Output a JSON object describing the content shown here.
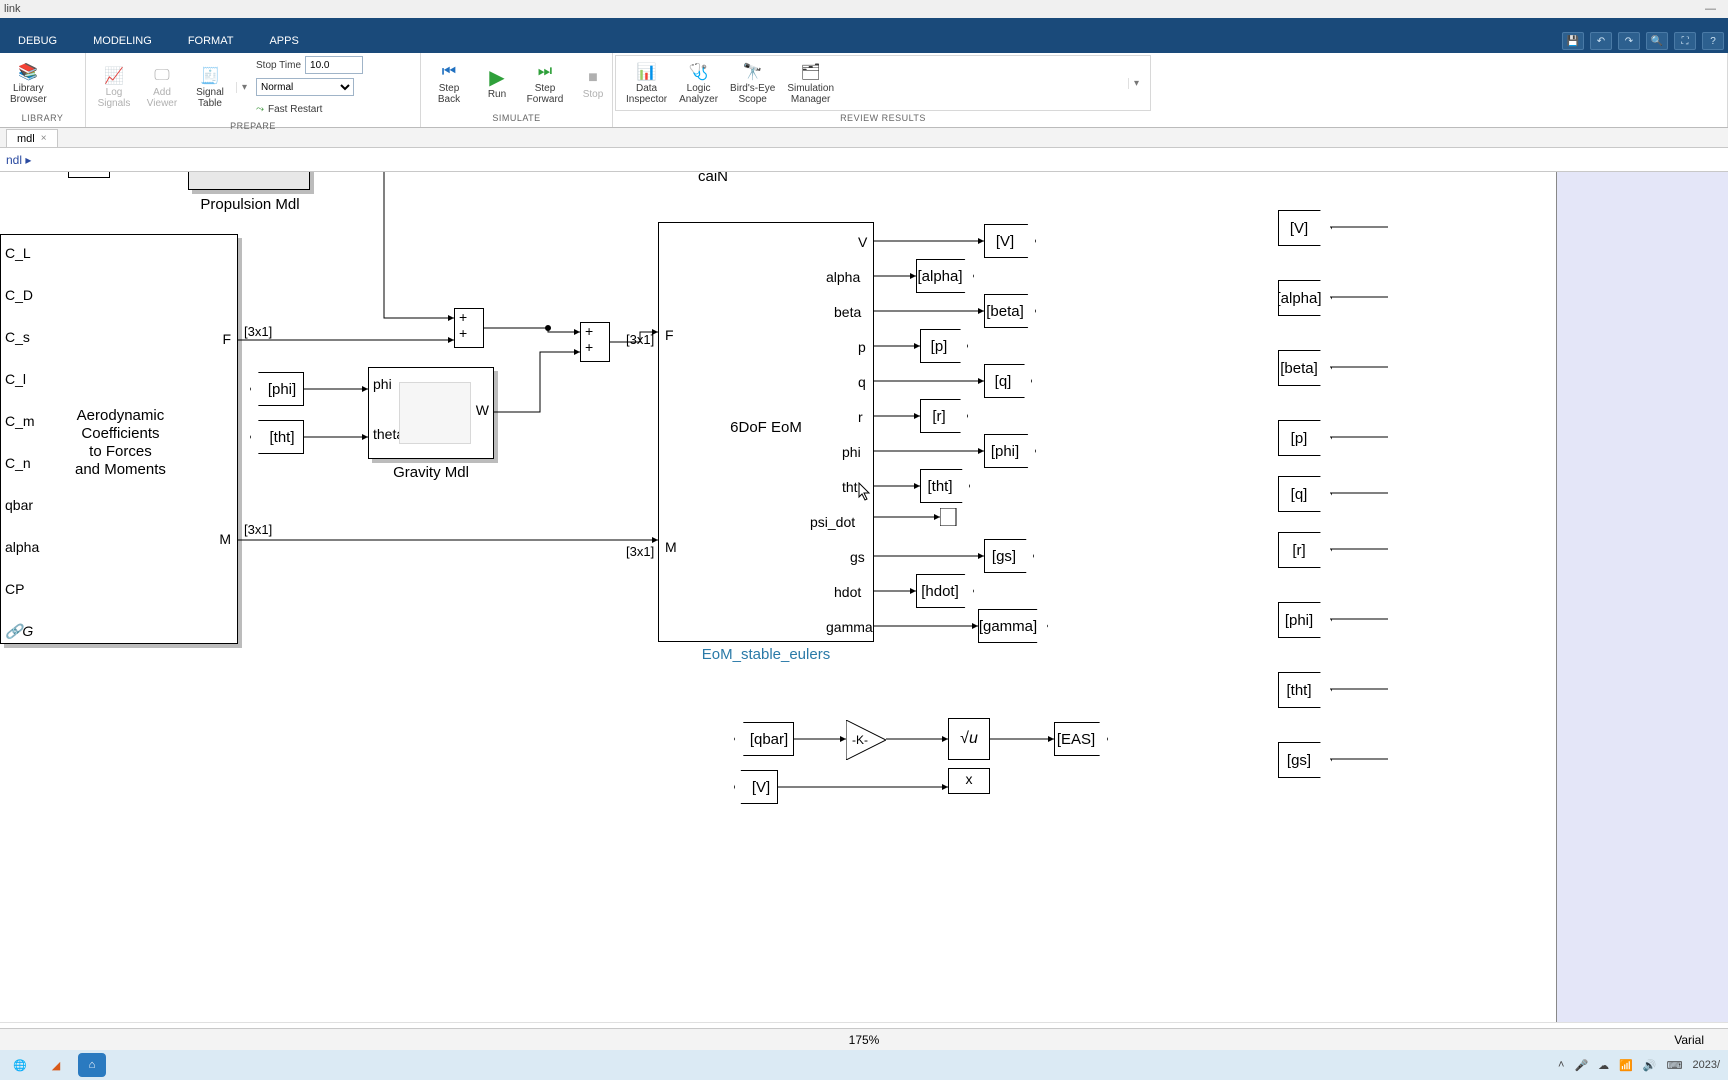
{
  "window": {
    "title": "link",
    "minimize_glyph": "—"
  },
  "tabs": {
    "debug": "DEBUG",
    "modeling": "MODELING",
    "format": "FORMAT",
    "apps": "APPS"
  },
  "ribbon": {
    "library": {
      "group": "LIBRARY",
      "library_browser": "Library\nBrowser"
    },
    "prepare": {
      "group": "PREPARE",
      "log_signals": "Log\nSignals",
      "add_viewer": "Add\nViewer",
      "signal_table": "Signal\nTable",
      "stop_time_label": "Stop Time",
      "stop_time_value": "10.0",
      "mode_value": "Normal",
      "fast_restart": "Fast Restart"
    },
    "simulate": {
      "group": "SIMULATE",
      "step_back": "Step\nBack",
      "run": "Run",
      "step_forward": "Step\nForward",
      "stop": "Stop"
    },
    "review": {
      "group": "REVIEW RESULTS",
      "data_inspector": "Data\nInspector",
      "logic_analyzer": "Logic\nAnalyzer",
      "birds_eye": "Bird's-Eye\nScope",
      "sim_manager": "Simulation\nManager"
    }
  },
  "doc": {
    "tab_name": "mdl",
    "breadcrumb": "ndl ▸"
  },
  "status": {
    "zoom": "175%",
    "right_text": "Varial"
  },
  "taskbar": {
    "clock": "2023/"
  },
  "canvas": {
    "text_can": "caiN",
    "blocks": {
      "propulsion": {
        "label": "Propulsion Mdl"
      },
      "aero": {
        "title_line1": "Aerodynamic",
        "title_line2": "Coefficients",
        "title_line3": "to Forces",
        "title_line4": "and Moments",
        "inputs": [
          "C_L",
          "C_D",
          "C_s",
          "C_l",
          "C_m",
          "C_n",
          "qbar",
          "alpha",
          "CP"
        ],
        "outputs": {
          "F": "F",
          "M": "M"
        },
        "link_glyph": "🔗G"
      },
      "gravity": {
        "label": "Gravity Mdl",
        "in_phi": "phi",
        "in_theta": "theta",
        "out_W": "W"
      },
      "from_phi": "[phi]",
      "from_tht": "[tht]",
      "sum1_ops": "+ +",
      "sum2_ops": "+ +",
      "eom": {
        "title": "6DoF EoM",
        "label_below": "EoM_stable_eulers",
        "in_F": "F",
        "in_M": "M",
        "outputs": [
          "V",
          "alpha",
          "beta",
          "p",
          "q",
          "r",
          "phi",
          "tht",
          "psi_dot",
          "gs",
          "hdot",
          "gamma"
        ]
      },
      "goto_tags": {
        "V": "[V]",
        "alpha": "[alpha]",
        "beta": "[beta]",
        "p": "[p]",
        "q": "[q]",
        "r": "[r]",
        "phi": "[phi]",
        "tht": "[tht]",
        "gs": "[gs]",
        "hdot": "[hdot]",
        "gamma": "[gamma]",
        "qbar": "[qbar]",
        "EAS": "[EAS]",
        "V2": "[V]"
      },
      "gain_K": "-K-",
      "sqrt_u": "√u",
      "prod_x": "x"
    },
    "from_scopes": [
      "[V]",
      "[alpha]",
      "[beta]",
      "[p]",
      "[q]",
      "[r]",
      "[phi]",
      "[tht]",
      "[gs]"
    ],
    "signal_dims": {
      "F_dim": "[3x1]",
      "M_dim": "[3x1]",
      "F_in_dim": "[3x1]",
      "M_in_dim": "[3x1]"
    }
  }
}
